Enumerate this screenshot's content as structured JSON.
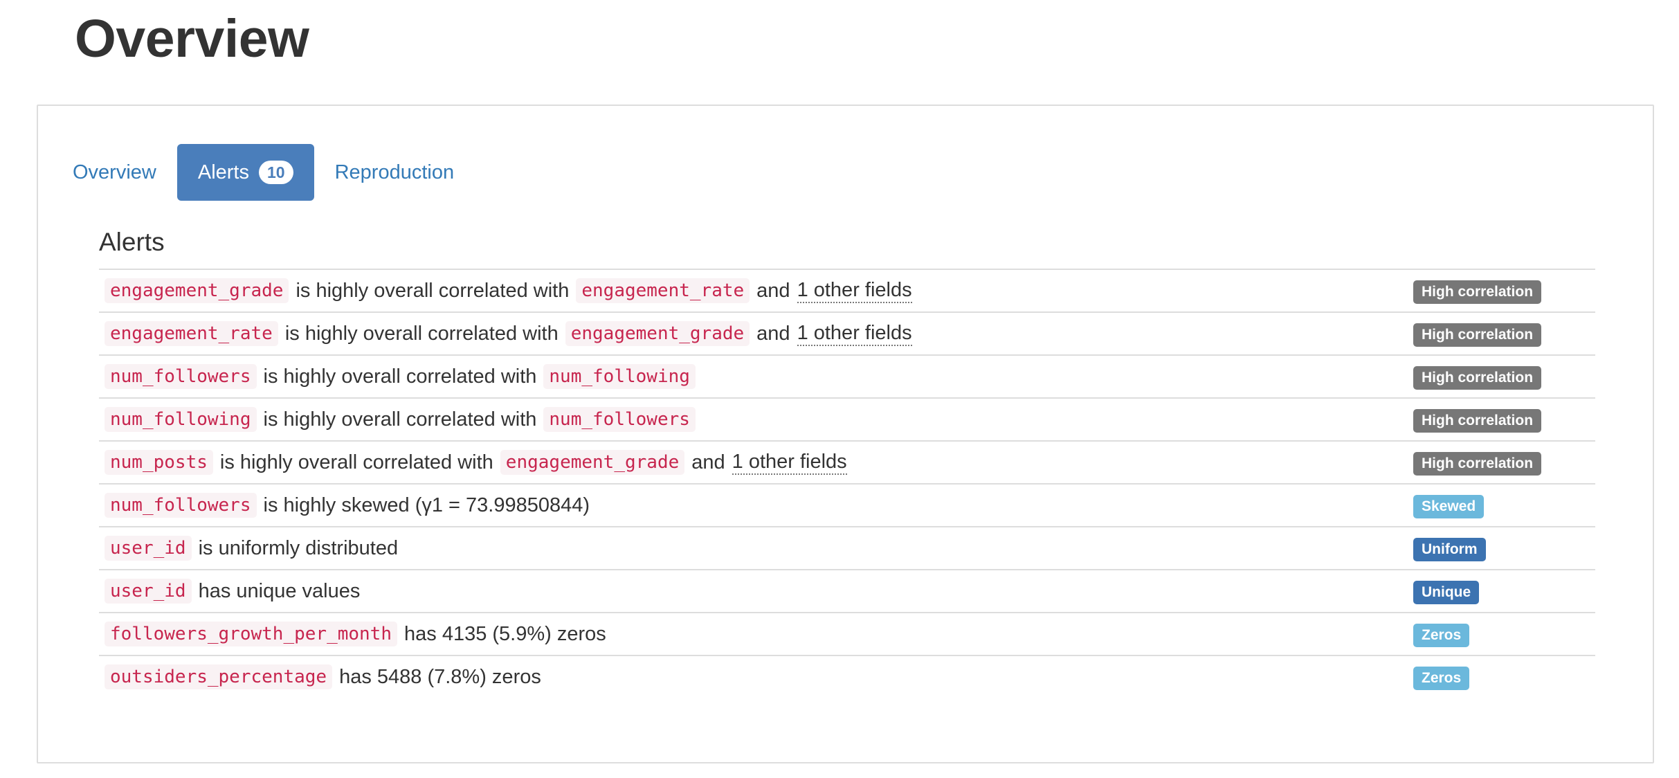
{
  "page": {
    "title": "Overview"
  },
  "tabs": [
    {
      "label": "Overview",
      "active": false
    },
    {
      "label": "Alerts",
      "badge": "10",
      "active": true
    },
    {
      "label": "Reproduction",
      "active": false
    }
  ],
  "alerts_heading": "Alerts",
  "colors": {
    "accent": "#4a7ebb",
    "link": "#337ab7",
    "code_text": "#c7254e",
    "code_bg": "#f9f2f4",
    "badge_high_correlation": "#777777",
    "badge_skewed": "#6bb8dc",
    "badge_uniform": "#3c73b1",
    "badge_unique": "#3c73b1",
    "badge_zeros": "#6bb8dc"
  },
  "alerts": [
    {
      "field": "engagement_grade",
      "text": "is highly overall correlated with",
      "target": "engagement_rate",
      "and": "and",
      "others": "1 other fields",
      "tail": "",
      "badge": "High correlation",
      "badge_color": "#777777"
    },
    {
      "field": "engagement_rate",
      "text": "is highly overall correlated with",
      "target": "engagement_grade",
      "and": "and",
      "others": "1 other fields",
      "tail": "",
      "badge": "High correlation",
      "badge_color": "#777777"
    },
    {
      "field": "num_followers",
      "text": "is highly overall correlated with",
      "target": "num_following",
      "and": "",
      "others": "",
      "tail": "",
      "badge": "High correlation",
      "badge_color": "#777777"
    },
    {
      "field": "num_following",
      "text": "is highly overall correlated with",
      "target": "num_followers",
      "and": "",
      "others": "",
      "tail": "",
      "badge": "High correlation",
      "badge_color": "#777777"
    },
    {
      "field": "num_posts",
      "text": "is highly overall correlated with",
      "target": "engagement_grade",
      "and": "and",
      "others": "1 other fields",
      "tail": "",
      "badge": "High correlation",
      "badge_color": "#777777"
    },
    {
      "field": "num_followers",
      "text": "is highly skewed (γ1 = 73.99850844)",
      "target": "",
      "and": "",
      "others": "",
      "tail": "",
      "badge": "Skewed",
      "badge_color": "#6bb8dc"
    },
    {
      "field": "user_id",
      "text": "is uniformly distributed",
      "target": "",
      "and": "",
      "others": "",
      "tail": "",
      "badge": "Uniform",
      "badge_color": "#3c73b1"
    },
    {
      "field": "user_id",
      "text": "has unique values",
      "target": "",
      "and": "",
      "others": "",
      "tail": "",
      "badge": "Unique",
      "badge_color": "#3c73b1"
    },
    {
      "field": "followers_growth_per_month",
      "text": "has 4135 (5.9%) zeros",
      "target": "",
      "and": "",
      "others": "",
      "tail": "",
      "badge": "Zeros",
      "badge_color": "#6bb8dc"
    },
    {
      "field": "outsiders_percentage",
      "text": "has 5488 (7.8%) zeros",
      "target": "",
      "and": "",
      "others": "",
      "tail": "",
      "badge": "Zeros",
      "badge_color": "#6bb8dc"
    }
  ]
}
